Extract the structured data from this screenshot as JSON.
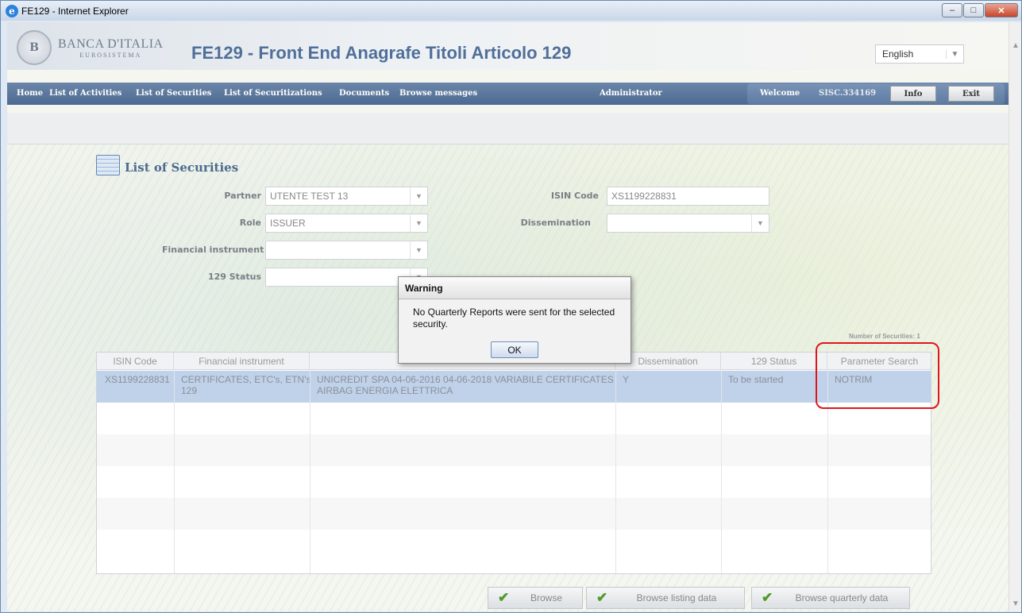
{
  "window": {
    "title": "FE129 - Internet Explorer",
    "controls": [
      "–",
      "□",
      "✕"
    ]
  },
  "header": {
    "logo_line1": "BANCA D'ITALIA",
    "logo_line2": "EUROSISTEMA",
    "app_title": "FE129 - Front End Anagrafe Titoli Articolo 129",
    "language": "English"
  },
  "nav": {
    "items": [
      "Home",
      "List of Activities",
      "List of Securities",
      "List of Securitizations",
      "Documents",
      "Browse messages"
    ],
    "admin": "Administrator",
    "welcome": "Welcome",
    "user": "SISC.334169",
    "info_label": "Info",
    "exit_label": "Exit"
  },
  "page": {
    "title": "List of Securities",
    "number_of_securities": "Number of Securities: 1"
  },
  "form": {
    "partner_label": "Partner",
    "partner_value": "UTENTE TEST 13",
    "role_label": "Role",
    "role_value": "ISSUER",
    "financial_instrument_label": "Financial instrument",
    "financial_instrument_value": "",
    "status_label": "129 Status",
    "status_value": "",
    "isin_label": "ISIN Code",
    "isin_value": "XS1199228831",
    "dissemination_label": "Dissemination",
    "dissemination_value": ""
  },
  "table": {
    "columns": [
      "ISIN Code",
      "Financial instrument",
      "",
      "Dissemination",
      "129 Status",
      "Parameter Search"
    ],
    "rows": [
      {
        "isin": "XS1199228831",
        "instrument_l1": "CERTIFICATES, ETC's, ETN's",
        "instrument_l2": "129",
        "description_l1": "UNICREDIT SPA 04-06-2016 04-06-2018 VARIABILE CERTIFICATES",
        "description_l2": "AIRBAG ENERGIA ELETTRICA",
        "dissemination": "Y",
        "status": "To be started",
        "parameter_search": "NOTRIM"
      }
    ]
  },
  "dialog": {
    "title": "Warning",
    "message": "No Quarterly Reports were sent for the selected security.",
    "ok_label": "OK"
  },
  "buttons": {
    "browse": "Browse",
    "browse_listing": "Browse listing data",
    "browse_quarterly": "Browse quarterly data"
  },
  "colors": {
    "nav_bar": "#4d6a91",
    "title_blue": "#4f6f9a",
    "highlight": "#e0151b",
    "selected_row": "#bfd2ea"
  }
}
